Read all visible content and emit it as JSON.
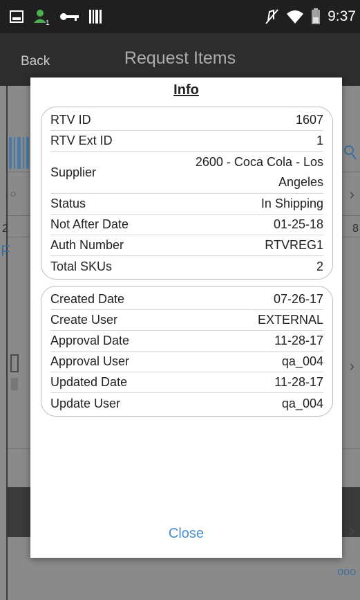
{
  "status_bar": {
    "time": "9:37",
    "icons": [
      "image-icon",
      "user-badge-icon",
      "key-icon",
      "barcode-icon",
      "mute-icon",
      "wifi-icon",
      "battery-icon"
    ]
  },
  "app_bar": {
    "back_label": "Back",
    "title": "Request Items"
  },
  "background": {
    "row_left_num": "2",
    "row_right_num": "8",
    "letter_f": "F",
    "letter_o": "O",
    "dots": "ooo"
  },
  "dialog": {
    "title": "Info",
    "group1": [
      {
        "label": "RTV ID",
        "value": "1607"
      },
      {
        "label": "RTV Ext ID",
        "value": "1"
      },
      {
        "label": "Supplier",
        "value": "2600 - Coca Cola - Los Angeles"
      },
      {
        "label": "Status",
        "value": "In Shipping"
      },
      {
        "label": "Not After Date",
        "value": "01-25-18"
      },
      {
        "label": "Auth Number",
        "value": "RTVREG1"
      },
      {
        "label": "Total SKUs",
        "value": "2"
      }
    ],
    "group2": [
      {
        "label": "Created Date",
        "value": "07-26-17"
      },
      {
        "label": "Create User",
        "value": "EXTERNAL"
      },
      {
        "label": "Approval Date",
        "value": "11-28-17"
      },
      {
        "label": "Approval User",
        "value": "qa_004"
      },
      {
        "label": "Updated Date",
        "value": "11-28-17"
      },
      {
        "label": "Update User",
        "value": "qa_004"
      }
    ],
    "close_label": "Close"
  },
  "colors": {
    "accent": "#4c8fd0",
    "statusbar": "#1f1f1f",
    "appbar": "#2d2d2d",
    "overlay": "#8c8c8c"
  }
}
